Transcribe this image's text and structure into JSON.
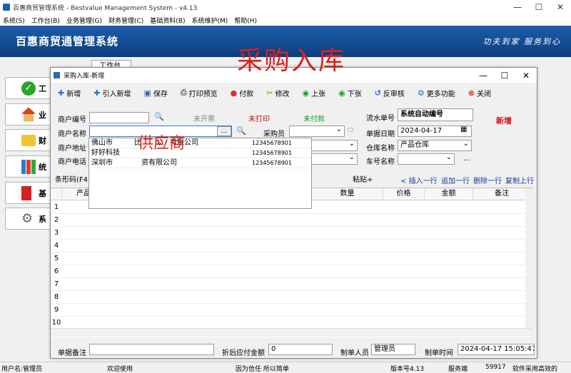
{
  "app": {
    "title": "百惠商贸管理系统 - Bestvalue Management System - v4.13",
    "brand": "百惠商贸通管理系统",
    "slogan": "功夫到家 服务到心",
    "overlay_title": "采购入库",
    "workbench_tab": "工作台"
  },
  "menu": [
    "系统(S)",
    "工作台(B)",
    "业务管理(G)",
    "财务管理(C)",
    "基础资料(B)",
    "系统维护(M)",
    "帮助(H)"
  ],
  "sidebar": [
    "工",
    "业",
    "财",
    "统",
    "基",
    "系"
  ],
  "dialog": {
    "title": "采购入库-新增",
    "toolbar": [
      "新增",
      "引入新增",
      "保存",
      "打印预览",
      "付款",
      "修改",
      "上张",
      "下张",
      "反审核",
      "更多功能",
      "关闭"
    ],
    "labels": {
      "merchant_code": "商户编号",
      "merchant_name": "商户名称",
      "merchant_addr": "商户地址",
      "merchant_phone": "商户电话",
      "no_invoice": "未开票",
      "not_printed": "未打印",
      "not_paid": "未付款",
      "serial_no": "流水单号",
      "buyer": "采购员",
      "doc_date": "单据日期",
      "warehouse": "仓库名称",
      "vehicle": "车号名称",
      "new_flag": "新增",
      "barcode": "条形码(F4)",
      "paste": "粘贴+",
      "remark": "单据备注",
      "discount_amount": "折后应付金额",
      "maker": "制单人员",
      "make_time": "制单时间"
    },
    "values": {
      "serial_no": "系统自动编号",
      "doc_date": "2024-04-17",
      "warehouse": "产品仓库",
      "discount_amount": "0",
      "maker": "管理员",
      "make_time": "2024-04-17 15:05:47"
    },
    "row_actions": [
      "插入一行",
      "追加一行",
      "删除一行",
      "复制上行"
    ],
    "columns": [
      "产品",
      "数量",
      "价格",
      "金额",
      "备注"
    ],
    "row_numbers": [
      "1",
      "2",
      "3",
      "4",
      "5",
      "6",
      "7",
      "8",
      "9",
      "10"
    ]
  },
  "dropdown": {
    "overlay_label": "供应商",
    "rows": [
      {
        "name": "佛山市　　　比　　公　有限公司",
        "phone": "12345678901"
      },
      {
        "name": "好好科技",
        "phone": "12345678901"
      },
      {
        "name": "深圳市　　　　资有限公司",
        "phone": "12345678901"
      }
    ]
  },
  "status": {
    "user": "用户名:管理员",
    "welcome": "欢迎使用",
    "motto": "因为信任 所以简单",
    "version": "版本号4.13",
    "service": "服务端",
    "port": "59917",
    "tagline": "软件采用高效的"
  },
  "colors": {
    "banner": "#1c5ea8",
    "red": "#e0201a",
    "green": "#1a9a1a"
  }
}
